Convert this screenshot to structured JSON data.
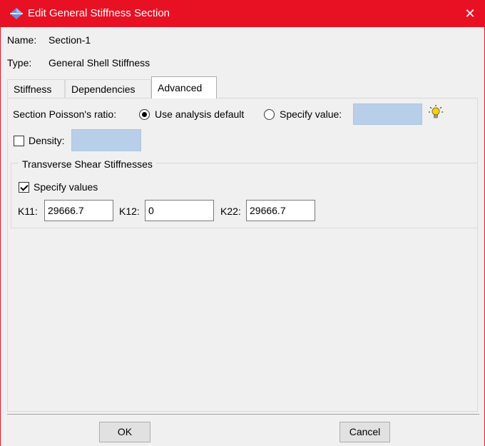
{
  "window": {
    "title": "Edit General Stiffness Section",
    "close_glyph": "✕"
  },
  "header": {
    "name_label": "Name:",
    "name_value": "Section-1",
    "type_label": "Type:",
    "type_value": "General Shell Stiffness"
  },
  "tabs": [
    {
      "label": "Stiffness",
      "active": false
    },
    {
      "label": "Dependencies",
      "active": false
    },
    {
      "label": "Advanced",
      "active": true
    }
  ],
  "advanced": {
    "poisson_label": "Section Poisson's ratio:",
    "option_default": "Use analysis default",
    "option_default_selected": true,
    "option_specify": "Specify value:",
    "option_specify_selected": false,
    "specify_value": "",
    "density_label": "Density:",
    "density_checked": false,
    "density_value": "",
    "shear_group_title": "Transverse Shear Stiffnesses",
    "specify_values_label": "Specify values",
    "specify_values_checked": true,
    "k11_label": "K11:",
    "k11_value": "29666.7",
    "k12_label": "K12:",
    "k12_value": "0",
    "k22_label": "K22:",
    "k22_value": "29666.7"
  },
  "buttons": {
    "ok": "OK",
    "cancel": "Cancel"
  },
  "colors": {
    "titlebar": "#e81123",
    "field_disabled": "#b7cfe8"
  },
  "icons": {
    "app": "abaqus-section-icon",
    "hint": "lightbulb-icon",
    "close": "close-icon"
  }
}
